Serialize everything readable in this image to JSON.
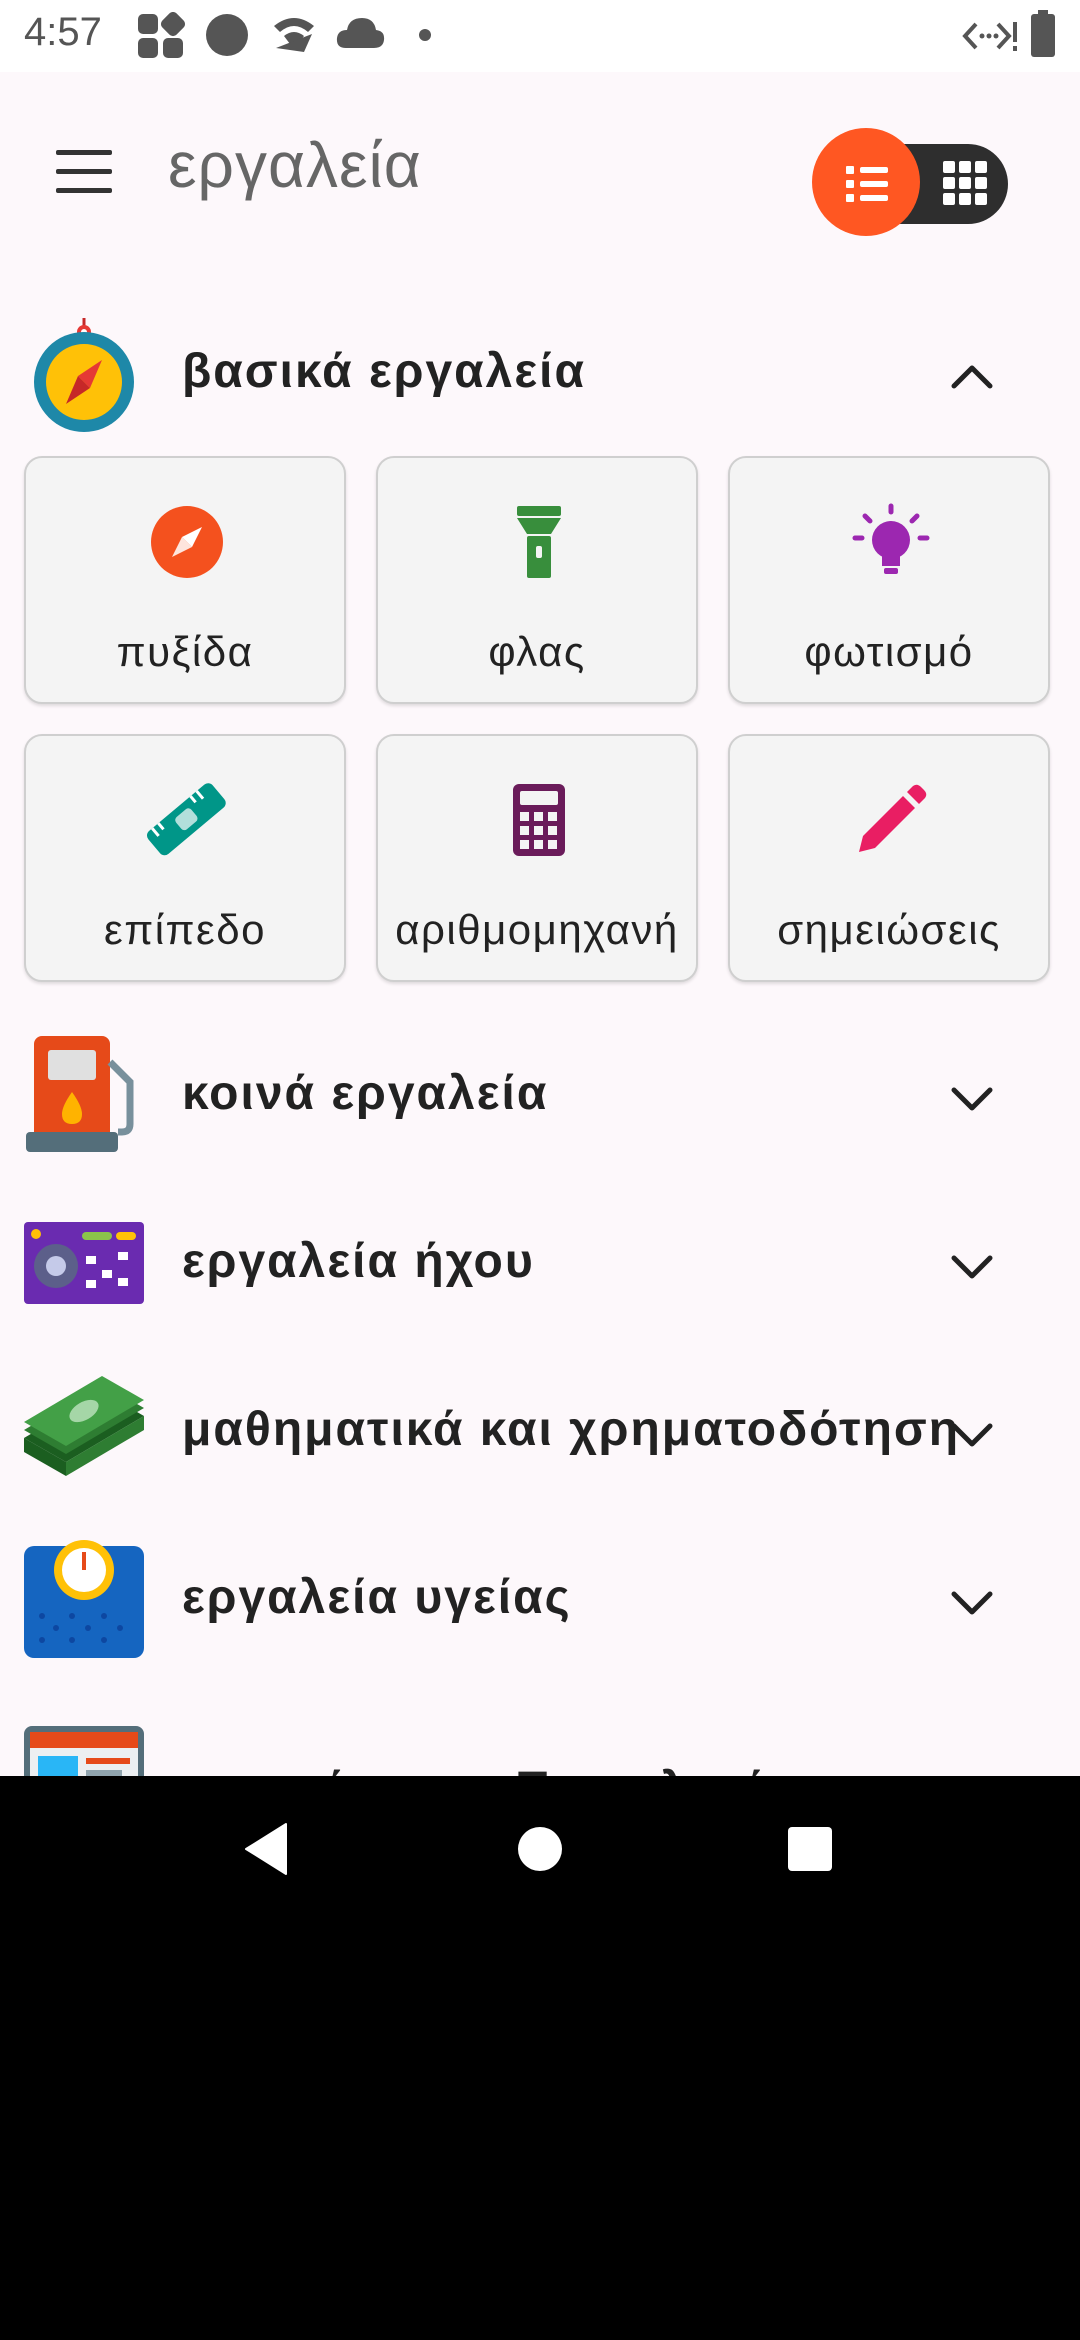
{
  "status_bar": {
    "time": "4:57",
    "icons": [
      "app-grid-icon",
      "circle-icon",
      "wifi-icon",
      "cloud-icon",
      "dot-icon",
      "code-icon",
      "battery-icon"
    ]
  },
  "app_bar": {
    "title": "εργαλεία",
    "menu_icon": "hamburger-menu-icon",
    "view_modes": [
      "list",
      "grid"
    ],
    "active_view": "list",
    "accent": "#ff5722"
  },
  "sections": [
    {
      "title": "βασικά εργαλεία",
      "icon": "compass-icon",
      "expanded": true,
      "tools": [
        {
          "label": "πυξίδα",
          "icon": "compass-icon",
          "color": "#f4511e"
        },
        {
          "label": "φλας",
          "icon": "flashlight-icon",
          "color": "#388e3c"
        },
        {
          "label": "φωτισμό",
          "icon": "lightbulb-icon",
          "color": "#9c27b0"
        },
        {
          "label": "επίπεδο",
          "icon": "level-ruler-icon",
          "color": "#009688"
        },
        {
          "label": "αριθμομηχανή",
          "icon": "calculator-icon",
          "color": "#6a1b5a"
        },
        {
          "label": "σημειώσεις",
          "icon": "pencil-icon",
          "color": "#e91e63"
        }
      ]
    },
    {
      "title": "κοινά εργαλεία",
      "icon": "fuel-pump-icon",
      "expanded": false
    },
    {
      "title": "εργαλεία ήχου",
      "icon": "audio-mixer-icon",
      "expanded": false
    },
    {
      "title": "μαθηματικά και χρηματοδότηση",
      "icon": "money-stack-icon",
      "expanded": false
    },
    {
      "title": "εργαλεία υγείας",
      "icon": "weight-scale-icon",
      "expanded": false
    },
    {
      "title": "επιστήμη και Τεχνολογία",
      "icon": "browser-window-icon",
      "expanded": false
    }
  ],
  "nav_bar": {
    "buttons": [
      "back-icon",
      "home-icon",
      "recents-icon"
    ]
  }
}
